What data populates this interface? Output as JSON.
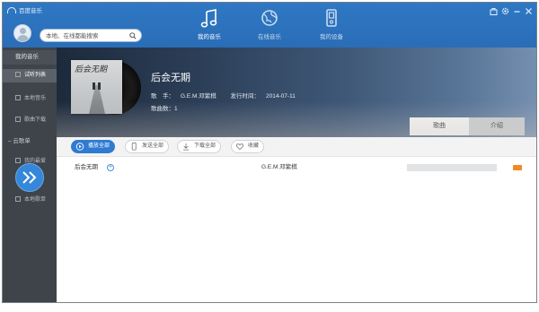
{
  "app": {
    "title": "百度音乐"
  },
  "search": {
    "placeholder": "本地、在线都能搜索"
  },
  "nav": [
    {
      "label": "我的音乐",
      "icon": "music-note-icon",
      "active": true
    },
    {
      "label": "在线音乐",
      "icon": "globe-icon",
      "active": false
    },
    {
      "label": "我的设备",
      "icon": "device-icon",
      "active": false
    }
  ],
  "window_controls": [
    "bag-icon",
    "gear-icon",
    "minimize-icon",
    "close-icon"
  ],
  "sidebar": {
    "title": "我的音乐",
    "items": [
      {
        "label": "试听列表"
      },
      {
        "label": "本地音乐"
      },
      {
        "label": "歌曲下载"
      }
    ],
    "group": "云歌单",
    "group_items": [
      {
        "label": "我的最爱"
      },
      {
        "label": "本地歌单"
      }
    ]
  },
  "album": {
    "title": "后会无期",
    "cover_text": "后会无期",
    "singer_label": "歌　手：",
    "singer": "G.E.M.邓紫棋",
    "release_label": "发行时间：",
    "release_date": "2014-07-11",
    "count_label": "歌曲数：",
    "count": "1"
  },
  "tabs": {
    "songs": "歌曲",
    "intro": "介绍"
  },
  "actions": {
    "play_all": "播放全部",
    "send_all": "发送全部",
    "download_all": "下载全部",
    "favorite": "收藏"
  },
  "songs": [
    {
      "name": "后会无期",
      "artist": "G.E.M.邓紫棋",
      "hq": true
    }
  ],
  "colors": {
    "accent": "#2f7bd2",
    "topbar": "#2a6db7",
    "sidebar": "#3f444a",
    "hq_badge": "#f08a24"
  }
}
